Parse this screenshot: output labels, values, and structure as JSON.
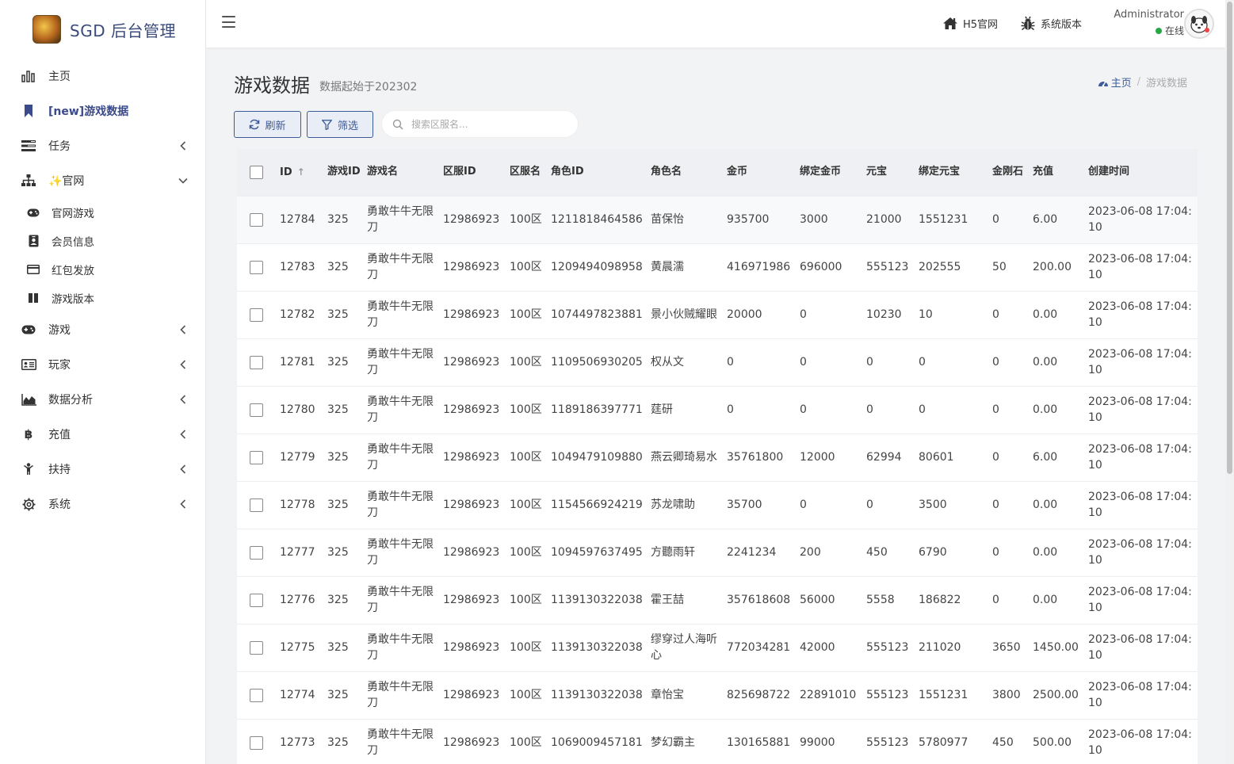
{
  "brand": {
    "title": "SGD 后台管理"
  },
  "sidebar": {
    "items": [
      {
        "label": "主页",
        "icon": "bar-chart-icon"
      },
      {
        "label": "[new]游戏数据",
        "icon": "bookmark-icon",
        "active": true
      },
      {
        "label": "任务",
        "icon": "tasks-icon"
      },
      {
        "label": "✨官网",
        "icon": "sitemap-icon"
      },
      {
        "label": "游戏",
        "icon": "gamepad-icon"
      },
      {
        "label": "玩家",
        "icon": "id-card-icon"
      },
      {
        "label": "数据分析",
        "icon": "area-chart-icon"
      },
      {
        "label": "充值",
        "icon": "bitcoin-icon"
      },
      {
        "label": "扶持",
        "icon": "child-icon"
      },
      {
        "label": "系统",
        "icon": "gear-icon"
      }
    ],
    "subitems": [
      {
        "label": "官网游戏",
        "icon": "gamepad-icon"
      },
      {
        "label": "会员信息",
        "icon": "id-badge-icon"
      },
      {
        "label": "红包发放",
        "icon": "credit-card-icon"
      },
      {
        "label": "游戏版本",
        "icon": "columns-icon"
      }
    ]
  },
  "header": {
    "links": [
      {
        "label": "H5官网",
        "icon": "home-icon"
      },
      {
        "label": "系统版本",
        "icon": "bug-icon"
      }
    ],
    "user": {
      "name": "Administrator",
      "status": "在线",
      "status_color": "#28a745"
    }
  },
  "page": {
    "title": "游戏数据",
    "subtitle": "数据起始于202302",
    "breadcrumb": {
      "home": "主页",
      "current": "游戏数据"
    }
  },
  "toolbar": {
    "refresh_label": "刷新",
    "filter_label": "筛选",
    "search_placeholder": "搜索区服名..."
  },
  "table": {
    "columns": [
      "ID",
      "游戏ID",
      "游戏名",
      "区服ID",
      "区服名",
      "角色ID",
      "角色名",
      "金币",
      "绑定金币",
      "元宝",
      "绑定元宝",
      "金刚石",
      "充值",
      "创建时间"
    ],
    "rows": [
      [
        "12784",
        "325",
        "勇敢牛牛无限刀",
        "12986923",
        "100区",
        "1211818464586",
        "苗保怡",
        "935700",
        "3000",
        "21000",
        "1551231",
        "0",
        "6.00",
        "2023-06-08 17:04:10"
      ],
      [
        "12783",
        "325",
        "勇敢牛牛无限刀",
        "12986923",
        "100区",
        "1209494098958",
        "黄晨濡",
        "416971986",
        "696000",
        "555123",
        "202555",
        "50",
        "200.00",
        "2023-06-08 17:04:10"
      ],
      [
        "12782",
        "325",
        "勇敢牛牛无限刀",
        "12986923",
        "100区",
        "1074497823881",
        "景小伙贼耀眼",
        "20000",
        "0",
        "10230",
        "10",
        "0",
        "0.00",
        "2023-06-08 17:04:10"
      ],
      [
        "12781",
        "325",
        "勇敢牛牛无限刀",
        "12986923",
        "100区",
        "1109506930205",
        "权从文",
        "0",
        "0",
        "0",
        "0",
        "0",
        "0.00",
        "2023-06-08 17:04:10"
      ],
      [
        "12780",
        "325",
        "勇敢牛牛无限刀",
        "12986923",
        "100区",
        "1189186397771",
        "莛研",
        "0",
        "0",
        "0",
        "0",
        "0",
        "0.00",
        "2023-06-08 17:04:10"
      ],
      [
        "12779",
        "325",
        "勇敢牛牛无限刀",
        "12986923",
        "100区",
        "1049479109880",
        "燕云卿琦易水",
        "35761800",
        "12000",
        "62994",
        "80601",
        "0",
        "6.00",
        "2023-06-08 17:04:10"
      ],
      [
        "12778",
        "325",
        "勇敢牛牛无限刀",
        "12986923",
        "100区",
        "1154566924219",
        "苏龙啸助",
        "35700",
        "0",
        "0",
        "3500",
        "0",
        "0.00",
        "2023-06-08 17:04:10"
      ],
      [
        "12777",
        "325",
        "勇敢牛牛无限刀",
        "12986923",
        "100区",
        "1094597637495",
        "方聽雨轩",
        "2241234",
        "200",
        "450",
        "6790",
        "0",
        "0.00",
        "2023-06-08 17:04:10"
      ],
      [
        "12776",
        "325",
        "勇敢牛牛无限刀",
        "12986923",
        "100区",
        "1139130322038",
        "霍王喆",
        "357618608",
        "56000",
        "5558",
        "186822",
        "0",
        "0.00",
        "2023-06-08 17:04:10"
      ],
      [
        "12775",
        "325",
        "勇敢牛牛无限刀",
        "12986923",
        "100区",
        "1139130322038",
        "缪穿过人海听心",
        "772034281",
        "42000",
        "555123",
        "211020",
        "3650",
        "1450.00",
        "2023-06-08 17:04:10"
      ],
      [
        "12774",
        "325",
        "勇敢牛牛无限刀",
        "12986923",
        "100区",
        "1139130322038",
        "章怡宝",
        "825698722",
        "22891010",
        "555123",
        "1551231",
        "3800",
        "2500.00",
        "2023-06-08 17:04:10"
      ],
      [
        "12773",
        "325",
        "勇敢牛牛无限刀",
        "12986923",
        "100区",
        "1069009457181",
        "梦幻霸主",
        "130165881",
        "99000",
        "555123",
        "5780977",
        "450",
        "500.00",
        "2023-06-08 17:04:10"
      ]
    ]
  },
  "colors": {
    "accent": "#3b5b9a",
    "active_nav": "#3b4a8a",
    "online": "#28a745"
  }
}
